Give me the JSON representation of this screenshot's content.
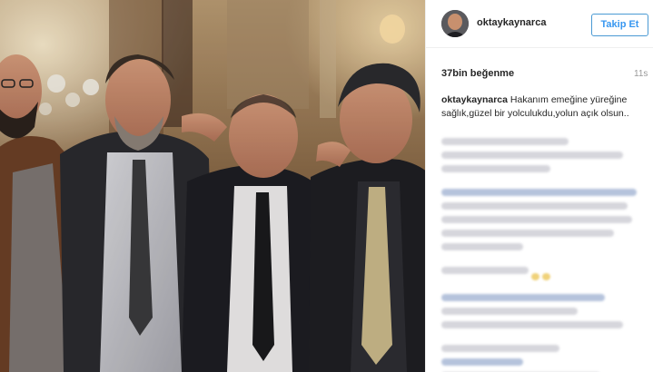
{
  "post": {
    "username": "oktaykaynarca",
    "follow_label": "Takip Et",
    "likes": "37bin beğenme",
    "time_ago": "11s",
    "caption_user": "oktaykaynarca",
    "caption_text": "Hakanım emeğine yüreğine sağlık,güzel bir yolculukdu,yolun açık olsun.."
  },
  "icons": {
    "avatar": "profile-avatar"
  }
}
